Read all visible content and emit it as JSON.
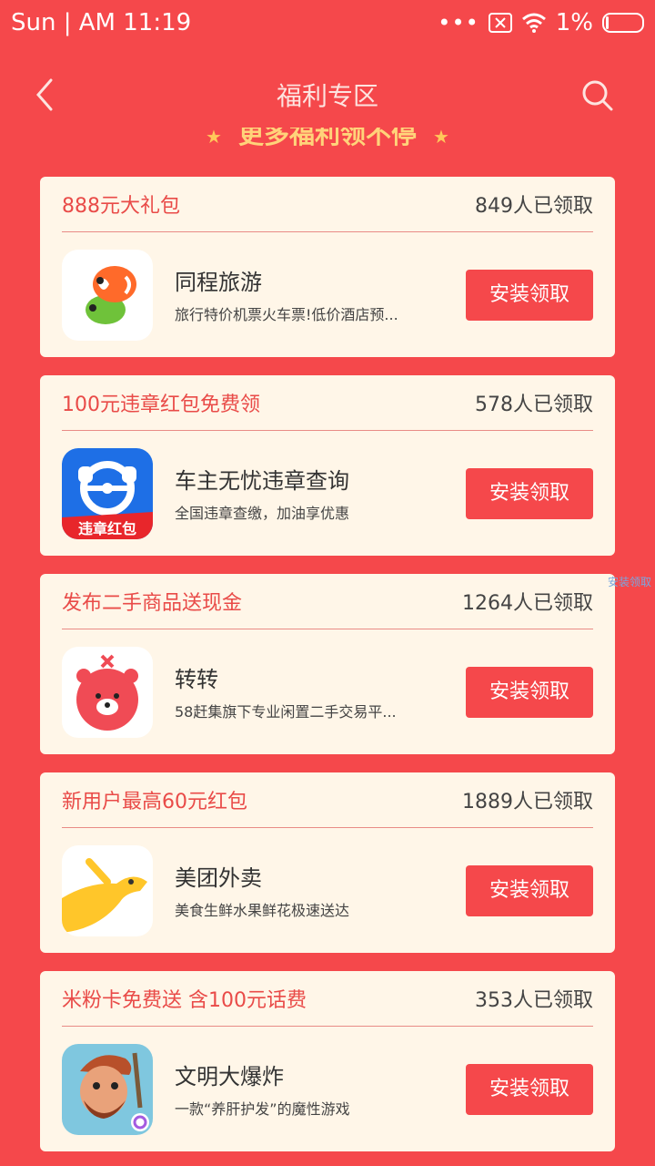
{
  "status_bar": {
    "time": "Sun | AM  11:19",
    "dots": "•••",
    "battery": "1%"
  },
  "nav": {
    "title": "福利专区",
    "banner": "更多福利领不停"
  },
  "cards": [
    {
      "title": "888元大礼包",
      "count": "849人已领取",
      "app_name": "同程旅游",
      "desc": "旅行特价机票火车票!低价酒店预...",
      "button": "安装领取"
    },
    {
      "title": "100元违章红包免费领",
      "count": "578人已领取",
      "app_name": "车主无忧违章查询",
      "desc": "全国违章查缴，加油享优惠",
      "button": "安装领取",
      "icon_text": "违章红包"
    },
    {
      "title": "发布二手商品送现金",
      "count": "1264人已领取",
      "app_name": "转转",
      "desc": "58赶集旗下专业闲置二手交易平...",
      "button": "安装领取"
    },
    {
      "title": "新用户最高60元红包",
      "count": "1889人已领取",
      "app_name": "美团外卖",
      "desc": "美食生鲜水果鲜花极速送达",
      "button": "安装领取"
    },
    {
      "title": "米粉卡免费送 含100元话费",
      "count": "353人已领取",
      "app_name": "文明大爆炸",
      "desc": "一款“养肝护发”的魔性游戏",
      "button": "安装领取"
    }
  ],
  "edge_text": "安装领取"
}
